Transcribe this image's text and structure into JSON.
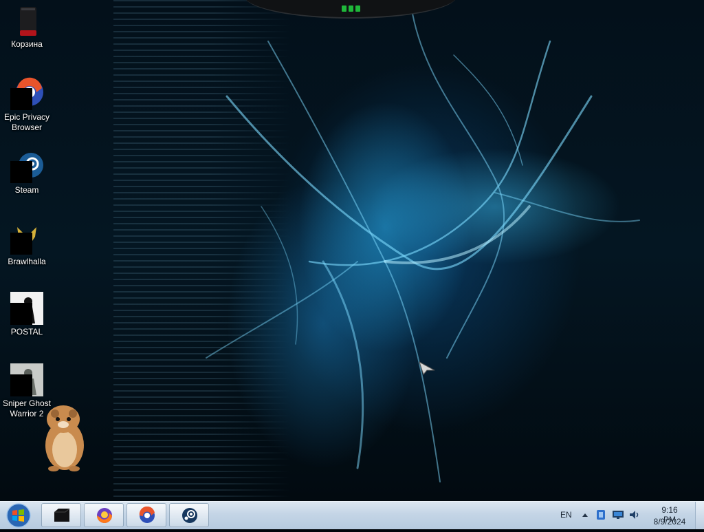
{
  "desktop": {
    "icons": [
      {
        "label": "Корзина",
        "icon": "recycle-bin-icon"
      },
      {
        "label": "Epic Privacy Browser",
        "icon": "epic-browser-icon"
      },
      {
        "label": "Steam",
        "icon": "steam-icon"
      },
      {
        "label": "Brawlhalla",
        "icon": "brawlhalla-icon"
      },
      {
        "label": "POSTAL",
        "icon": "postal-icon"
      },
      {
        "label": "Sniper Ghost Warrior 2",
        "icon": "sniper-ghost-warrior-icon"
      }
    ]
  },
  "taskbar": {
    "start_icon": "windows-start-icon",
    "pinned": [
      {
        "name": "file-manager",
        "icon": "black-box-icon"
      },
      {
        "name": "firefox",
        "icon": "firefox-icon"
      },
      {
        "name": "epic-browser",
        "icon": "epic-browser-icon"
      },
      {
        "name": "steam",
        "icon": "steam-icon"
      }
    ],
    "language": "EN",
    "time": "9:16 PM",
    "date": "8/9/2024"
  }
}
